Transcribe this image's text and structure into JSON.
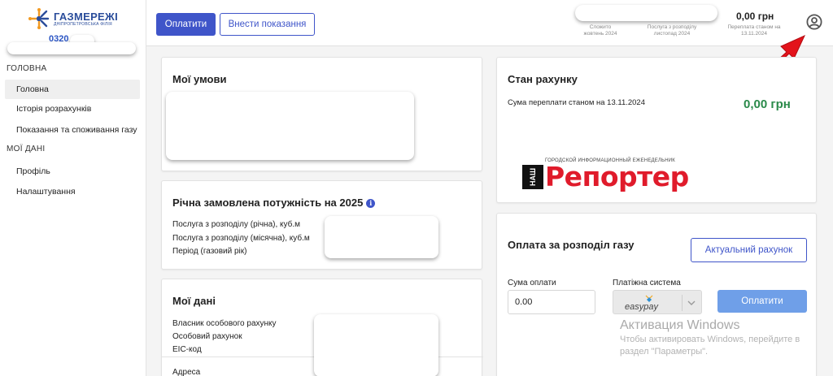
{
  "brand": {
    "title": "ГАЗМЕРЕЖІ",
    "subtitle": "ДНІПРОПЕТРОВСЬКА ФІЛІЯ",
    "account_number_prefix": "0320"
  },
  "sidebar": {
    "sections": [
      {
        "header": "ГОЛОВНА",
        "items": [
          {
            "label": "Головна",
            "active": true
          },
          {
            "label": "Історія розрахунків",
            "active": false
          },
          {
            "label": "Показання та споживання газу",
            "active": false
          }
        ]
      },
      {
        "header": "МОЇ ДАНІ",
        "items": [
          {
            "label": "Профіль",
            "active": false
          },
          {
            "label": "Налаштування",
            "active": false
          }
        ]
      }
    ]
  },
  "topbar": {
    "pay_button": "Оплатити",
    "meter_button": "Внести показання",
    "stats": [
      {
        "line1": "Сложито",
        "line2": "жовтень 2024"
      },
      {
        "line1": "Послуга з розподілу",
        "line2": "листопад 2024"
      },
      {
        "line1": "Переплата станом на",
        "line2": "13.11.2024"
      }
    ],
    "overpayment_amount": "0,00 грн"
  },
  "cards": {
    "my_terms": {
      "title": "Мої умови"
    },
    "annual_capacity": {
      "title": "Річна замовлена потужність на 2025",
      "rows": [
        "Послуга з розподілу (річна), куб.м",
        "Послуга з розподілу (місячна), куб.м",
        "Період (газовий рік)"
      ]
    },
    "my_data": {
      "title": "Мої дані",
      "rows": [
        "Власник особового рахунку",
        "Особовий рахунок",
        "ЕІС-код",
        "Адреса"
      ]
    },
    "account_status": {
      "title": "Стан рахунку",
      "label": "Сума переплати станом на 13.11.2024",
      "amount": "0,00 грн"
    },
    "reporter_ad": {
      "small": "ГОРОДСКОЙ ИНФОРМАЦИОННЫЙ ЕЖЕНЕДЕЛЬНИК",
      "nash": "НАШ",
      "big": "Репортер"
    },
    "payment": {
      "title": "Оплата за розподіл газу",
      "current_invoice_button": "Актуальний рахунок",
      "amount_label": "Сума оплати",
      "amount_value": "0.00",
      "system_label": "Платіжна система",
      "system_value": "easypay",
      "pay_button": "Оплатити"
    }
  },
  "watermark": {
    "title": "Активация Windows",
    "text": "Чтобы активировать Windows, перейдите в раздел \"Параметры\"."
  },
  "colors": {
    "primary": "#3f55c9",
    "amount_green": "#2a8a4a",
    "arrow_red": "#e3131b",
    "reporter_red": "#e01b2b"
  }
}
